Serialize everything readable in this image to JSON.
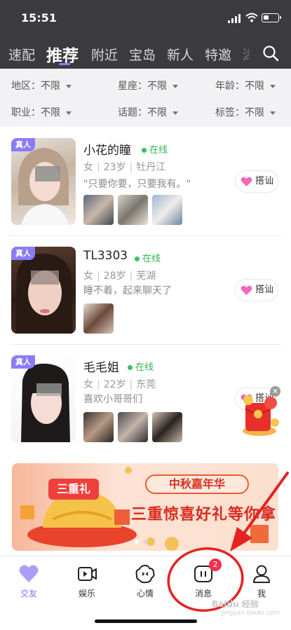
{
  "status_bar": {
    "time": "15:51"
  },
  "tabs": [
    {
      "label": "速配",
      "active": false
    },
    {
      "label": "推荐",
      "active": true
    },
    {
      "label": "附近",
      "active": false
    },
    {
      "label": "宝岛",
      "active": false
    },
    {
      "label": "新人",
      "active": false
    },
    {
      "label": "特邀",
      "active": false
    },
    {
      "label": "湖",
      "active": false
    }
  ],
  "filters": [
    {
      "label": "地区：",
      "value": "不限"
    },
    {
      "label": "星座：",
      "value": "不限"
    },
    {
      "label": "年龄：",
      "value": "不限"
    },
    {
      "label": "职业：",
      "value": "不限"
    },
    {
      "label": "话题：",
      "value": "不限"
    },
    {
      "label": "标签：",
      "value": "不限"
    }
  ],
  "users": [
    {
      "badge": "真人",
      "name": "小花的瞳",
      "online": "在线",
      "gender": "女",
      "age": "23岁",
      "city": "牡丹江",
      "motto": "\"只要你要，只要我有。\"",
      "greet": "搭讪"
    },
    {
      "badge": "真人",
      "name": "TL3303",
      "online": "在线",
      "gender": "女",
      "age": "28岁",
      "city": "芜湖",
      "motto": "睡不着，起来聊天了",
      "greet": "搭讪"
    },
    {
      "badge": "真人",
      "name": "毛毛姐",
      "online": "在线",
      "gender": "女",
      "age": "22岁",
      "city": "东莞",
      "motto": "喜欢小哥哥们",
      "greet": "搭讪"
    }
  ],
  "banner": {
    "tag": "三重礼",
    "event": "中秋嘉年华",
    "headline": "三重惊喜好礼等你拿"
  },
  "bottom_nav": [
    {
      "label": "交友",
      "icon": "heart-icon",
      "active": true
    },
    {
      "label": "娱乐",
      "icon": "video-icon",
      "active": false
    },
    {
      "label": "心情",
      "icon": "mood-icon",
      "active": false
    },
    {
      "label": "消息",
      "icon": "message-icon",
      "active": false,
      "badge": "2"
    },
    {
      "label": "我",
      "icon": "profile-icon",
      "active": false
    }
  ],
  "watermark": {
    "text": "Baidu 经验",
    "sub": "jingyan.baidu.com"
  },
  "colors": {
    "accent": "#8c7dff",
    "online": "#35c35d",
    "annotation": "#e52222",
    "badge": "#f0324e"
  }
}
